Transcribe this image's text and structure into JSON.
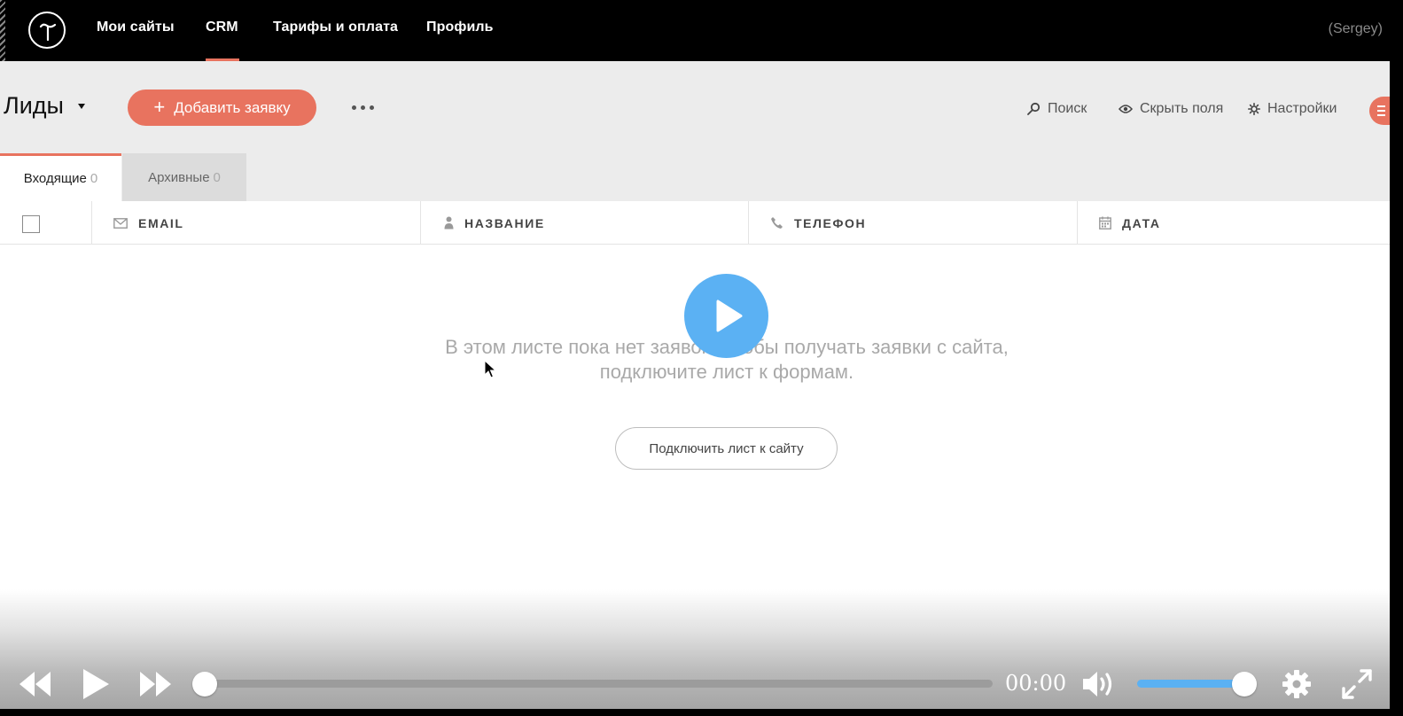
{
  "nav": {
    "items": [
      "Мои сайты",
      "CRM",
      "Тарифы и оплата",
      "Профиль"
    ],
    "active": "CRM",
    "user": "(Sergey)"
  },
  "toolbar": {
    "sheet_title": "Лиды",
    "add_label": "Добавить заявку",
    "search_label": "Поиск",
    "hide_fields_label": "Скрыть поля",
    "settings_label": "Настройки"
  },
  "tabs": [
    {
      "label": "Входящие",
      "count": "0",
      "active": true
    },
    {
      "label": "Архивные",
      "count": "0",
      "active": false
    }
  ],
  "table": {
    "columns": [
      {
        "label": "EMAIL",
        "icon": "envelope-icon"
      },
      {
        "label": "НАЗВАНИЕ",
        "icon": "person-icon"
      },
      {
        "label": "ТЕЛЕФОН",
        "icon": "phone-icon"
      },
      {
        "label": "ДАТА",
        "icon": "calendar-icon"
      }
    ]
  },
  "empty_state": {
    "line1": "В этом листе пока нет заявок. Чтобы получать заявки с сайта,",
    "line2": "подключите лист к формам.",
    "button": "Подключить лист к сайту"
  },
  "player": {
    "time": "00:00",
    "progress": 0,
    "volume": 1,
    "accent": "#5bb1f3"
  },
  "colors": {
    "accent": "#e8735f",
    "nav_bg": "#000000",
    "toolbar_bg": "#ececec"
  }
}
